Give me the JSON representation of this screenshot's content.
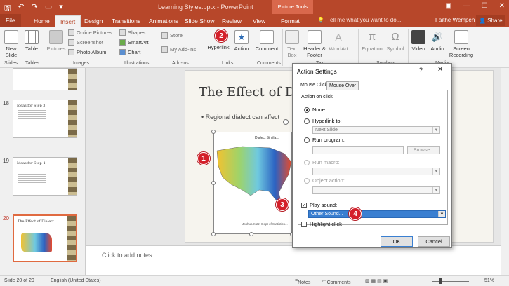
{
  "titlebar": {
    "title": "Learning Styles.pptx - PowerPoint",
    "context_tools": "Picture Tools",
    "qat": [
      "save-icon",
      "undo-icon",
      "redo-icon",
      "start-icon",
      "customize-icon"
    ]
  },
  "tabs": [
    "File",
    "Home",
    "Insert",
    "Design",
    "Transitions",
    "Animations",
    "Slide Show",
    "Review",
    "View",
    "Format"
  ],
  "tell_me": "Tell me what you want to do...",
  "user": "Faithe Wempen",
  "share": "Share",
  "ribbon": {
    "new_slide": "New Slide",
    "table": "Table",
    "pictures": "Pictures",
    "online_pictures": "Online Pictures",
    "screenshot": "Screenshot",
    "photo_album": "Photo Album",
    "shapes": "Shapes",
    "smartart": "SmartArt",
    "chart": "Chart",
    "store": "Store",
    "my_addins": "My Add-ins",
    "hyperlink": "Hyperlink",
    "action": "Action",
    "comment": "Comment",
    "text_box": "Text Box",
    "header_footer": "Header & Footer",
    "wordart": "WordArt",
    "equation": "Equation",
    "symbol": "Symbol",
    "video": "Video",
    "audio": "Audio",
    "screen_recording": "Screen Recording",
    "groups": [
      "Slides",
      "Tables",
      "Images",
      "Illustrations",
      "Add-ins",
      "Links",
      "Comments",
      "Text",
      "Symbols",
      "Media"
    ]
  },
  "thumbnails": [
    {
      "num": "18",
      "title": "Ideas for Step 3"
    },
    {
      "num": "19",
      "title": "Ideas for Step 4"
    },
    {
      "num": "20",
      "title": "The Effect of Dialect"
    }
  ],
  "slide": {
    "title": "The Effect of Dial",
    "bullet": "Regional dialect can affect",
    "map_title": "Dialect Simila...",
    "map_caption": "Joshua Katz, Dept of Statistics..."
  },
  "notes_placeholder": "Click to add notes",
  "dialog": {
    "title": "Action Settings",
    "help": "?",
    "close": "✕",
    "tabs": [
      "Mouse Click",
      "Mouse Over"
    ],
    "group_label": "Action on click",
    "none": "None",
    "hyperlink_to": "Hyperlink to:",
    "hyperlink_value": "Next Slide",
    "run_program": "Run program:",
    "browse": "Browse...",
    "run_macro": "Run macro:",
    "object_action": "Object action:",
    "play_sound": "Play sound:",
    "sound_value": "Other Sound...",
    "highlight_click": "Highlight click",
    "ok": "OK",
    "cancel": "Cancel"
  },
  "callouts": [
    "1",
    "2",
    "3",
    "4"
  ],
  "status": {
    "slide": "Slide 20 of 20",
    "language": "English (United States)",
    "notes": "Notes",
    "comments": "Comments",
    "zoom": "51%"
  },
  "colors": {
    "accent": "#b7472a",
    "callout": "#d4202a",
    "highlight": "#3a7fd1"
  }
}
